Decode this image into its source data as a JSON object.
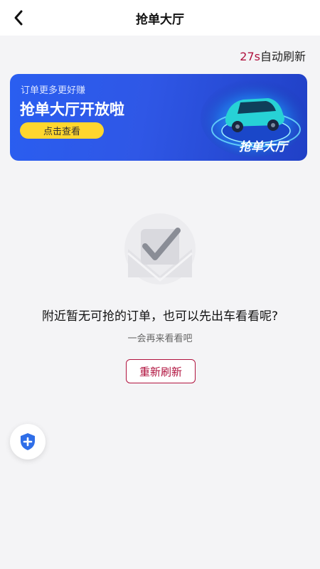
{
  "header": {
    "title": "抢单大厅",
    "back_icon": "chevron-left-icon"
  },
  "refresh": {
    "countdown": "27s",
    "label": "自动刷新",
    "accent": "#b0123e"
  },
  "banner": {
    "subtitle": "订单更多更好赚",
    "title": "抢单大厅开放啦",
    "button_label": "点击查看",
    "art_text": "抢单大厅",
    "bg_color": "#2f57e6",
    "button_color": "#ffd62e"
  },
  "empty": {
    "icon": "checkmark-icon",
    "title": "附近暂无可抢的订单，也可以先出车看看呢?",
    "subtitle": "一会再来看看吧",
    "retry_label": "重新刷新"
  },
  "floating": {
    "icon": "shield-plus-icon",
    "color": "#2f6ee8"
  }
}
